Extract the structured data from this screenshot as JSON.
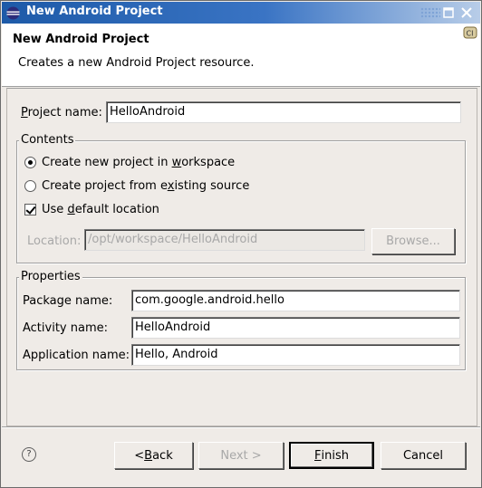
{
  "window": {
    "title": "New Android Project"
  },
  "header": {
    "title": "New Android Project",
    "description": "Creates a new Android Project resource."
  },
  "project_name": {
    "label_u": "P",
    "label_rest": "roject name:",
    "value": "HelloAndroid"
  },
  "contents": {
    "title": "Contents",
    "radio_new": {
      "pre": "Create new project in ",
      "u": "w",
      "post": "orkspace",
      "checked": true
    },
    "radio_existing": {
      "pre": "Create project from e",
      "u": "x",
      "post": "isting source",
      "checked": false
    },
    "default_location": {
      "pre": "Use ",
      "u": "d",
      "post": "efault location",
      "checked": true
    },
    "location": {
      "label": "Location:",
      "value": "/opt/workspace/HelloAndroid"
    },
    "browse": {
      "label": "Browse..."
    }
  },
  "properties": {
    "title": "Properties",
    "package": {
      "label": "Package name:",
      "value": "com.google.android.hello"
    },
    "activity": {
      "label": "Activity name:",
      "value": "HelloAndroid"
    },
    "application": {
      "label": "Application name:",
      "value": "Hello, Android"
    }
  },
  "buttons": {
    "back": {
      "pre": "< ",
      "u": "B",
      "post": "ack"
    },
    "next": {
      "label": "Next >"
    },
    "finish": {
      "u": "F",
      "post": "inish"
    },
    "cancel": {
      "label": "Cancel"
    }
  },
  "help": {
    "glyph": "?"
  },
  "colors": {
    "titlebar": "#1d5aa8",
    "dialog_bg": "#efebe7",
    "disabled_text": "#a8a8a8"
  }
}
